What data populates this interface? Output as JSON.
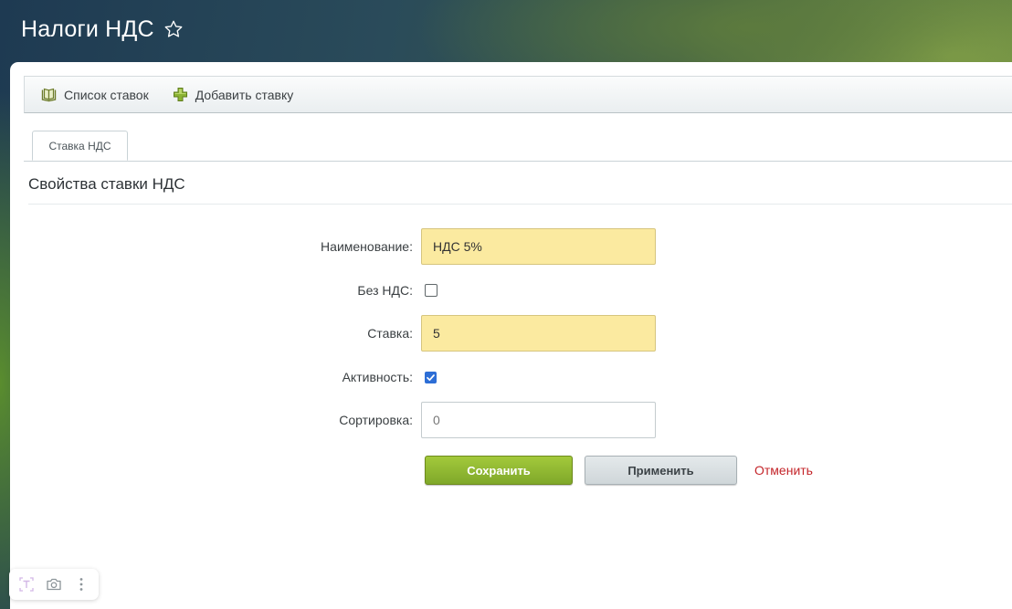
{
  "header": {
    "title": "Налоги НДС",
    "favorite_icon": "star-outline-icon"
  },
  "toolbar": {
    "list_label": "Список ставок",
    "list_icon": "book-icon",
    "add_label": "Добавить ставку",
    "add_icon": "green-plus-icon"
  },
  "tabs": [
    {
      "label": "Ставка НДС",
      "active": true
    }
  ],
  "section": {
    "title": "Свойства ставки НДС"
  },
  "form": {
    "name": {
      "label": "Наименование:",
      "value": "НДС 5%"
    },
    "no_vat": {
      "label": "Без НДС:",
      "checked": false
    },
    "rate": {
      "label": "Ставка:",
      "value": "5"
    },
    "active": {
      "label": "Активность:",
      "checked": true
    },
    "sort": {
      "label": "Сортировка:",
      "value": "0"
    }
  },
  "buttons": {
    "save": "Сохранить",
    "apply": "Применить",
    "cancel": "Отменить"
  },
  "floating_panel": {
    "icons": [
      "text-recognition-icon",
      "camera-icon",
      "more-vertical-icon"
    ]
  },
  "colors": {
    "required_field_bg": "#fbeaa0",
    "save_button": "#8db530",
    "cancel_link": "#c4252a",
    "checkbox_checked": "#2d6ed6"
  }
}
